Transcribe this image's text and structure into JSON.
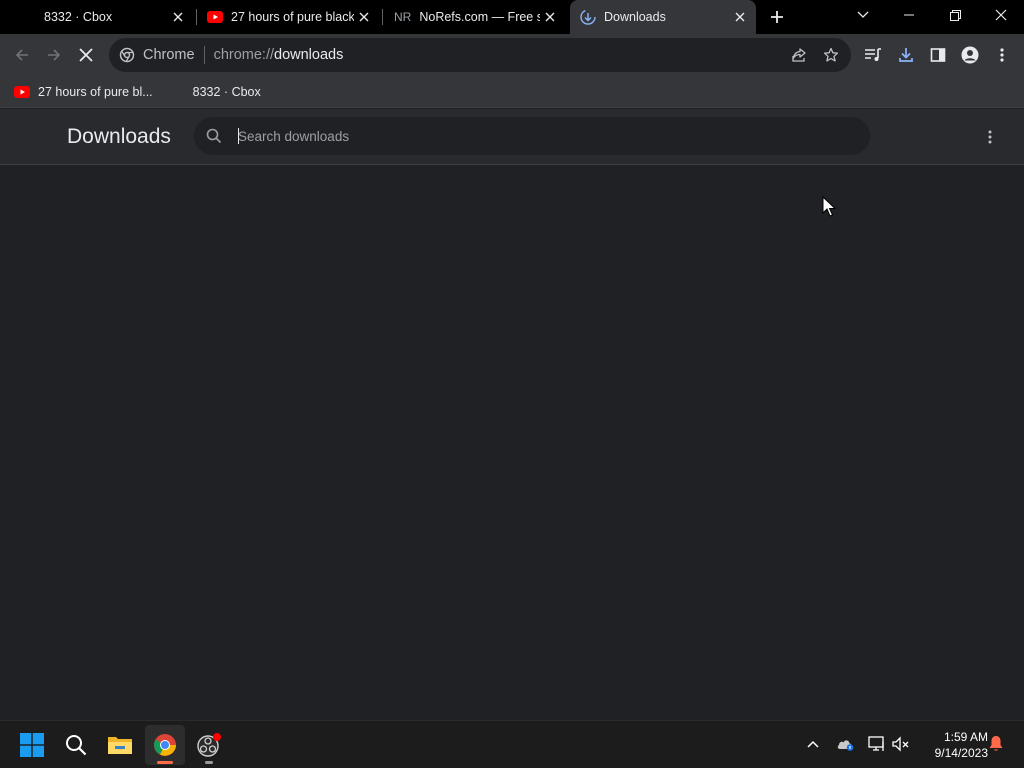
{
  "window": {
    "tabs": [
      {
        "title": "8332 · Cbox",
        "favicon": "none",
        "active": false
      },
      {
        "title": "27 hours of pure black",
        "favicon": "youtube-icon",
        "active": false
      },
      {
        "title": "NoRefs.com — Free se",
        "favicon_text": "NR",
        "active": false
      },
      {
        "title": "Downloads",
        "favicon": "download-icon",
        "active": true
      }
    ]
  },
  "toolbar": {
    "omnibox_chip": "Chrome",
    "url_scheme": "chrome://",
    "url_host": "downloads"
  },
  "bookmarks": [
    {
      "label": "27 hours of pure bl...",
      "icon": "youtube-icon"
    },
    {
      "label": "8332 · Cbox",
      "icon": "none"
    }
  ],
  "downloads_page": {
    "title": "Downloads",
    "search_placeholder": "Search downloads"
  },
  "taskbar": {
    "time": "1:59 AM",
    "date": "9/14/2023",
    "colors": {
      "accent": "#ff6b4a",
      "youtube": "#ff0000",
      "windows": "#0078d4"
    }
  }
}
